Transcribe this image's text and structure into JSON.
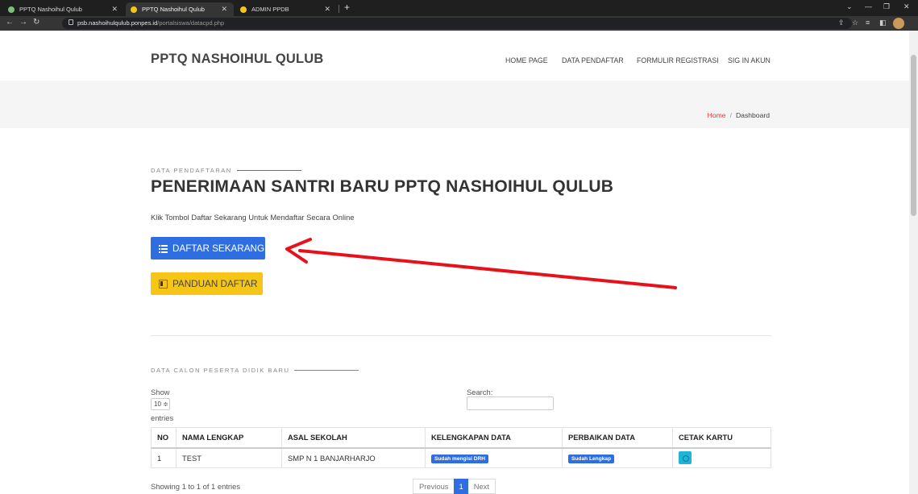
{
  "browser": {
    "tabs": [
      {
        "title": "PPTQ Nashoihul Qulub",
        "favicon_color": "#7cc07a"
      },
      {
        "title": "PPTQ Nashoihul Qulub",
        "favicon_color": "#f5c518"
      },
      {
        "title": "ADMIN PPDB",
        "favicon_color": "#f5c518"
      }
    ],
    "url_host": "psb.nashoihulqulub.ponpes.id",
    "url_path": "/portalsiswa/datacpd.php"
  },
  "site": {
    "logo": "PPTQ NASHOIHUL QULUB",
    "nav": [
      "HOME PAGE",
      "DATA PENDAFTAR",
      "FORMULIR REGISTRASI",
      "SIG IN AKUN"
    ],
    "breadcrumb": {
      "home": "Home",
      "current": "Dashboard"
    }
  },
  "main": {
    "kicker": "DATA PENDAFTARAN",
    "headline": "PENERIMAAN SANTRI BARU PPTQ NASHOIHUL QULUB",
    "lead": "Klik Tombol Daftar Sekarang Untuk Mendaftar Secara Online",
    "register_button": "DAFTAR SEKARANG",
    "guide_button": "PANDUAN DAFTAR",
    "annotation_arrow_color": "#e8111a"
  },
  "table_section": {
    "kicker": "DATA CALON PESERTA DIDIK BARU",
    "show_label": "Show",
    "page_size": "10 ≑",
    "entries_label": "entries",
    "search_label": "Search:",
    "columns": [
      "NO",
      "NAMA LENGKAP",
      "ASAL SEKOLAH",
      "KELENGKAPAN DATA",
      "PERBAIKAN DATA",
      "CETAK KARTU"
    ],
    "rows": [
      {
        "no": "1",
        "name": "TEST",
        "school": "SMP N 1 BANJARHARJO",
        "completeness": "Sudah mengisi DRH",
        "correction": "Sudah Lengkap"
      }
    ],
    "info": "Showing 1 to 1 of 1 entries",
    "pagination": {
      "prev": "Previous",
      "current": "1",
      "next": "Next"
    }
  }
}
